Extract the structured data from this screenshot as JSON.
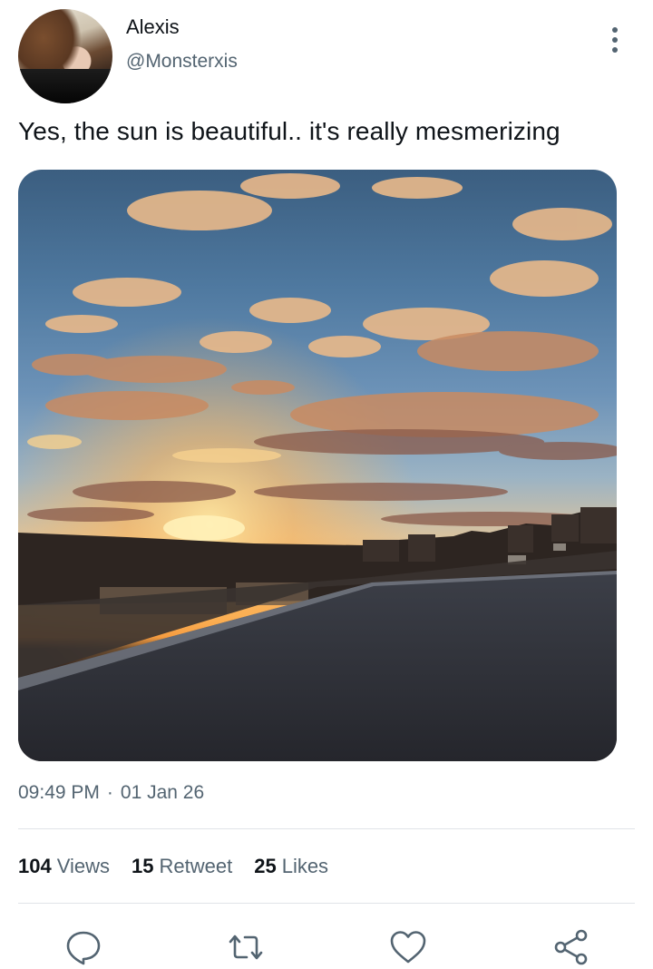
{
  "tweet": {
    "author_name": "Alexis",
    "author_handle": "@Monsterxis",
    "text": "Yes, the sun is beautiful.. it's really mesmerizing",
    "time": "09:49 PM",
    "separator": "·",
    "date": "01 Jan 26"
  },
  "stats": [
    {
      "count": "104",
      "label": "Views"
    },
    {
      "count": "15",
      "label": "Retweet"
    },
    {
      "count": "25",
      "label": "Likes"
    }
  ],
  "actions": [
    {
      "icon": "reply-icon"
    },
    {
      "icon": "retweet-icon"
    },
    {
      "icon": "like-icon"
    },
    {
      "icon": "share-icon"
    }
  ],
  "colors": {
    "text_primary": "#0f1419",
    "text_secondary": "#536471",
    "divider": "#e1e4e8",
    "icon": "#536471"
  }
}
